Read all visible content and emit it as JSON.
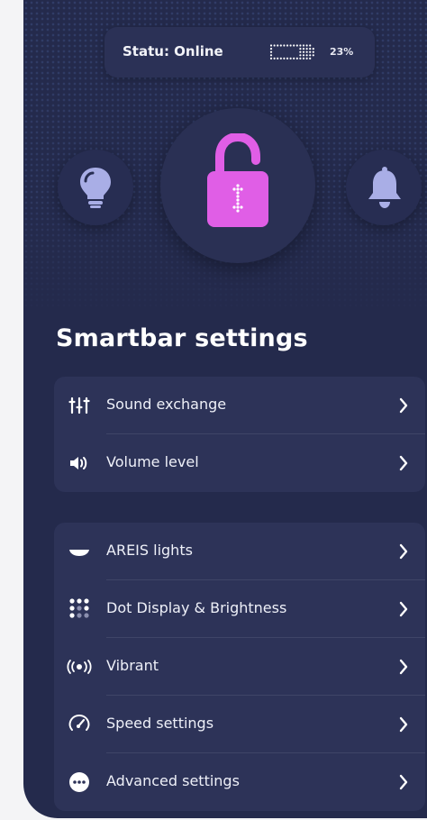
{
  "status": {
    "text": "Statu: Online",
    "battery_percent_label": "23%",
    "battery_level": 0.23
  },
  "quick_controls": {
    "left_icon": "lightbulb-icon",
    "center_icon": "unlocked-padlock-icon",
    "right_icon": "bell-icon"
  },
  "colors": {
    "background": "#242a4c",
    "card": "#2d3358",
    "accent_pink": "#e05ee6",
    "icon_lavender": "#a9aee6"
  },
  "settings": {
    "title": "Smartbar settings",
    "group1": [
      {
        "label": "Sound exchange",
        "icon": "equalizer-icon"
      },
      {
        "label": "Volume level",
        "icon": "speaker-icon"
      }
    ],
    "group2": [
      {
        "label": "AREIS lights",
        "icon": "lights-icon"
      },
      {
        "label": "Dot Display & Brightness",
        "icon": "dot-grid-icon"
      },
      {
        "label": "Vibrant",
        "icon": "vibration-icon"
      },
      {
        "label": "Speed settings",
        "icon": "speedometer-icon"
      },
      {
        "label": "Advanced settings",
        "icon": "more-dots-icon"
      }
    ]
  }
}
